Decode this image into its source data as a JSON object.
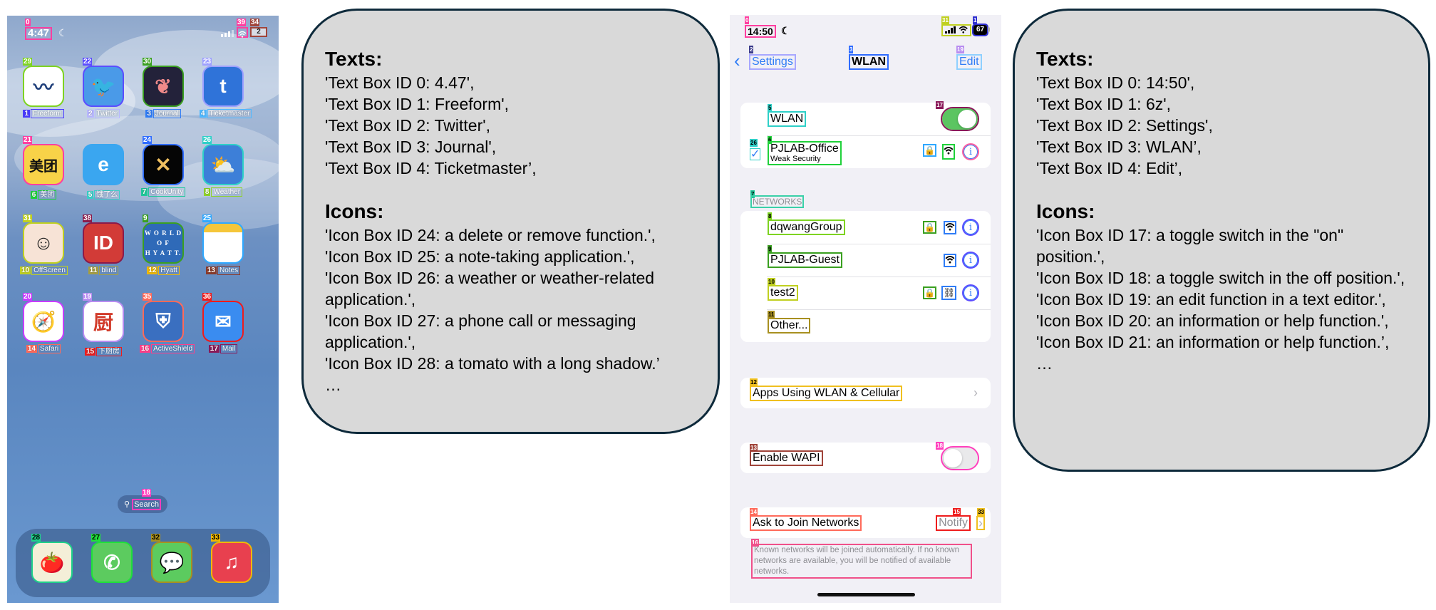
{
  "colors": {
    "ios_blue": "#2f7cf6",
    "toggle_on": "#5bc561",
    "toggle_off": "#e9e9eb",
    "bubble_bg": "#d9d9d9",
    "bubble_border": "#0e2a3b"
  },
  "home_screen": {
    "status": {
      "time": "4:47",
      "time_box_id": "0",
      "wifi_box_id": "39",
      "battery_box_id": "34",
      "battery_label": "2"
    },
    "apps": [
      {
        "name": "Freeform",
        "icon_box_id": "29",
        "text_box_id": "1",
        "icon": "freeform-icon",
        "glyph": "〰",
        "bg": "#ffffff",
        "fg": "#1f3f7a",
        "box_color": "#7ed321",
        "label_color": "#4a3aff"
      },
      {
        "name": "Twitter",
        "icon_box_id": "22",
        "text_box_id": "2",
        "icon": "twitter-bird-icon",
        "glyph": "🐦",
        "bg": "#4a9ae8",
        "fg": "#ffffff",
        "box_color": "#5b4dff",
        "label_color": "#b8b8ff"
      },
      {
        "name": "Journal",
        "icon_box_id": "30",
        "text_box_id": "3",
        "icon": "journal-butterfly-icon",
        "glyph": "❦",
        "bg": "#23223a",
        "fg": "#f08a8a",
        "box_color": "#3aa020",
        "label_color": "#2f7cf6"
      },
      {
        "name": "Ticketmaster",
        "icon_box_id": "23",
        "text_box_id": "4",
        "icon": "ticketmaster-t-icon",
        "glyph": "t",
        "bg": "#2f73d9",
        "fg": "#ffffff",
        "box_color": "#9ea0ff",
        "label_color": "#4fb8ff"
      },
      {
        "name": "美团",
        "icon_box_id": "21",
        "text_box_id": "6",
        "icon": "meituan-icon",
        "glyph": "美团",
        "bg": "#f8d248",
        "fg": "#111111",
        "box_color": "#ff3fa0",
        "label_color": "#1fd13a"
      },
      {
        "name": "饿了么",
        "icon_box_id": "",
        "text_box_id": "5",
        "icon": "eleme-icon",
        "glyph": "e",
        "bg": "#3aa6f0",
        "fg": "#ffffff",
        "box_color": "transparent",
        "label_color": "#3ad0c8"
      },
      {
        "name": "CookUnity",
        "icon_box_id": "24",
        "text_box_id": "7",
        "icon": "cookunity-x-icon",
        "glyph": "✕",
        "bg": "#050505",
        "fg": "#f0c060",
        "box_color": "#2f6cff",
        "label_color": "#1fc89a"
      },
      {
        "name": "Weather",
        "icon_box_id": "26",
        "text_box_id": "8",
        "icon": "weather-cloud-sun-icon",
        "glyph": "⛅",
        "bg": "#3d7fd8",
        "fg": "#ffffff",
        "box_color": "#2fd0c8",
        "label_color": "#8fd12a"
      },
      {
        "name": "OffScreen",
        "icon_box_id": "31",
        "text_box_id": "10",
        "icon": "offscreen-face-icon",
        "glyph": "☺",
        "bg": "#f7e3d6",
        "fg": "#222222",
        "box_color": "#c0d020",
        "label_color": "#c0d020"
      },
      {
        "name": "blind",
        "icon_box_id": "38",
        "text_box_id": "11",
        "icon": "blind-logo-icon",
        "glyph": "ID",
        "bg": "#d23b37",
        "fg": "#ffffff",
        "box_color": "#8a1a4a",
        "label_color": "#a8a040"
      },
      {
        "name": "Hyatt",
        "icon_box_id": "9",
        "text_box_id": "12",
        "icon": "world-of-hyatt-icon",
        "glyph": "W O R L D\nO F\nH Y A T T.",
        "bg": "#2f6ab8",
        "fg": "#ffffff",
        "box_color": "#3aa020",
        "label_color": "#f0b800"
      },
      {
        "name": "Notes",
        "icon_box_id": "25",
        "text_box_id": "13",
        "icon": "notes-icon",
        "glyph": "",
        "bg": "#ffffff",
        "fg": "#f5c63a",
        "box_color": "#2fa8ff",
        "label_color": "#8a3a2a"
      },
      {
        "name": "Safari",
        "icon_box_id": "20",
        "text_box_id": "14",
        "icon": "safari-compass-icon",
        "glyph": "🧭",
        "bg": "#ffffff",
        "fg": "#2f7cf6",
        "box_color": "#c83cff",
        "label_color": "#ff6a5a"
      },
      {
        "name": "下厨房",
        "icon_box_id": "19",
        "text_box_id": "15",
        "icon": "xiachufang-icon",
        "glyph": "厨",
        "bg": "#ffffff",
        "fg": "#d23b2a",
        "box_color": "#b88cf0",
        "label_color": "#ee1c1c"
      },
      {
        "name": "ActiveShield",
        "icon_box_id": "35",
        "text_box_id": "16",
        "icon": "activeshield-shield-icon",
        "glyph": "⛨",
        "bg": "#3a6fc0",
        "fg": "#ffffff",
        "box_color": "#ff6a5a",
        "label_color": "#ff3f8a"
      },
      {
        "name": "Mail",
        "icon_box_id": "36",
        "text_box_id": "17",
        "icon": "mail-envelope-icon",
        "glyph": "✉",
        "bg": "#3a8cf0",
        "fg": "#ffffff",
        "box_color": "#ee1c1c",
        "label_color": "#8a1a5a"
      }
    ],
    "extra_box_ids": {
      "blind_secondary": "40",
      "offscreen_secondary": "37"
    },
    "search": {
      "label": "Search",
      "box_id": "18"
    },
    "dock": [
      {
        "name": "Tomato",
        "icon_box_id": "28",
        "icon": "tomato-icon",
        "glyph": "🍅",
        "bg": "#f4efd8",
        "box_color": "#1fd18a"
      },
      {
        "name": "Phone",
        "icon_box_id": "27",
        "icon": "phone-icon",
        "glyph": "✆",
        "bg": "#5ccb5f",
        "box_color": "#1fe03a"
      },
      {
        "name": "Messages",
        "icon_box_id": "32",
        "icon": "messages-bubble-icon",
        "glyph": "💬",
        "bg": "#5ccb5f",
        "box_color": "#a89020"
      },
      {
        "name": "Music",
        "icon_box_id": "33",
        "icon": "music-note-icon",
        "glyph": "♫",
        "bg": "#e8404f",
        "box_color": "#f0b800"
      }
    ]
  },
  "bubble1": {
    "texts_heading": "Texts:",
    "texts": [
      "'Text Box ID 0: 4.47',",
      "'Text Box ID 1: Freeform',",
      "'Text Box ID 2: Twitter',",
      "'Text Box ID 3: Journal',",
      "'Text Box ID 4: Ticketmaster’,"
    ],
    "icons_heading": "Icons:",
    "icons": [
      " 'Icon Box ID 24: a delete or remove function.',",
      " 'Icon Box ID 25: a note-taking application.',",
      " 'Icon Box ID 26: a weather or weather-related application.',",
      " 'Icon Box ID 27: a phone call or messaging application.',",
      " 'Icon Box ID 28: a tomato with a long shadow.’",
      " …"
    ]
  },
  "wlan_screen": {
    "status": {
      "time": "14:50",
      "time_box_id": "0",
      "signal_box_id": "31",
      "battery": "67",
      "battery_box_id": "1"
    },
    "nav": {
      "back_label": "Settings",
      "back_box_id": "2",
      "title": "WLAN",
      "title_box_id": "3",
      "edit_label": "Edit",
      "edit_box_id": "19"
    },
    "wlan_row": {
      "label": "WLAN",
      "box_id": "5",
      "toggle_box_id": "17",
      "on": true
    },
    "connected": {
      "name": "PJLAB-Office",
      "subtitle": "Weak Security",
      "box_id": "6",
      "check_box_id": "26",
      "lock_box_id": "25",
      "wifi_box_id": "27",
      "info_box_id": "21"
    },
    "networks_header": "NETWORKS",
    "networks_header_box_id": "7",
    "networks": [
      {
        "name": "dqwangGroup",
        "box_id": "8",
        "lock": true,
        "lock_box_id": "30",
        "signal": "wifi",
        "signal_box_id": "24",
        "info_box_id": "20"
      },
      {
        "name": "PJLAB-Guest",
        "box_id": "9",
        "lock": false,
        "lock_box_id": "",
        "signal": "wifi",
        "signal_box_id": "29",
        "info_box_id": "22"
      },
      {
        "name": "test2",
        "box_id": "10",
        "lock": true,
        "lock_box_id": "32",
        "signal": "link",
        "signal_box_id": "28",
        "info_box_id": "23"
      },
      {
        "name": "Other...",
        "box_id": "11"
      }
    ],
    "apps_using": {
      "label": "Apps Using WLAN & Cellular",
      "box_id": "12"
    },
    "wapi": {
      "label": "Enable WAPI",
      "box_id": "13",
      "toggle_box_id": "18",
      "on": false
    },
    "ask_join": {
      "label": "Ask to Join Networks",
      "box_id": "14",
      "value": "Notify",
      "value_box_id": "15",
      "chevron_box_id": "33"
    },
    "footer_note": "Known networks will be joined automatically. If no known networks are available, you will be notified of available networks.",
    "footer_box_id": "16",
    "info_glyph": "i",
    "chevron_glyph": "›",
    "back_glyph": "‹",
    "check_glyph": "✓",
    "lock_glyph": "🔒"
  },
  "bubble2": {
    "texts_heading": "Texts:",
    "texts": [
      "'Text Box ID 0: 14:50',",
      " 'Text Box ID 1: 6z',",
      " 'Text Box ID 2: Settings',",
      " 'Text Box ID 3: WLAN’,",
      " 'Text Box ID 4: Edit’,"
    ],
    "icons_heading": "Icons:",
    "icons": [
      "'Icon Box ID 17: a toggle switch in the \"on\" position.',",
      " 'Icon Box ID 18: a toggle switch in the off position.',",
      " 'Icon Box ID 19: an edit function in a text editor.',",
      " 'Icon Box ID 20: an information or help function.',",
      " 'Icon Box ID 21: an information or help function.’,",
      " …"
    ]
  }
}
